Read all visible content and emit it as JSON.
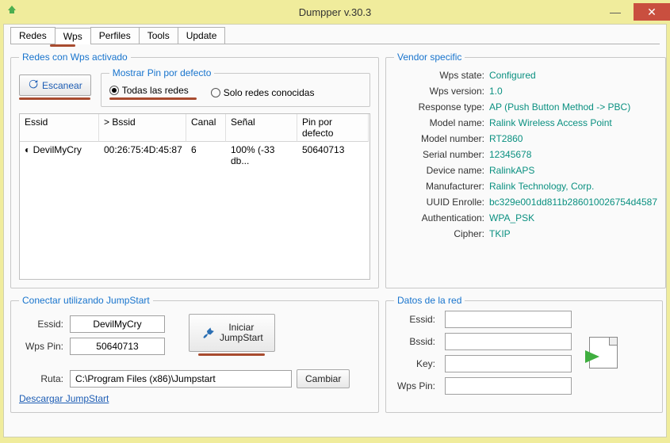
{
  "window": {
    "title": "Dumpper v.30.3"
  },
  "tabs": [
    "Redes",
    "Wps",
    "Perfiles",
    "Tools",
    "Update"
  ],
  "active_tab_index": 1,
  "scan": {
    "group_label": "Redes con Wps activado",
    "button": "Escanear",
    "pin_default_label": "Mostrar Pin por defecto",
    "radio_all": "Todas las redes",
    "radio_known": "Solo redes conocidas"
  },
  "table": {
    "headers": {
      "essid": "Essid",
      "bssid": "> Bssid",
      "canal": "Canal",
      "senal": "Señal",
      "pin": "Pin por defecto"
    },
    "rows": [
      {
        "essid": "DevilMyCry",
        "bssid": "00:26:75:4D:45:87",
        "canal": "6",
        "senal": "100% (-33 db...",
        "pin": "50640713"
      }
    ]
  },
  "vendor": {
    "group_label": "Vendor specific",
    "rows": [
      {
        "label": "Wps state:",
        "value": "Configured"
      },
      {
        "label": "Wps version:",
        "value": "1.0"
      },
      {
        "label": "Response type:",
        "value": "AP (Push Button Method -> PBC)"
      },
      {
        "label": "Model name:",
        "value": "Ralink Wireless Access Point"
      },
      {
        "label": "Model number:",
        "value": "RT2860"
      },
      {
        "label": "Serial number:",
        "value": "12345678"
      },
      {
        "label": "Device name:",
        "value": "RalinkAPS"
      },
      {
        "label": "Manufacturer:",
        "value": "Ralink Technology, Corp."
      },
      {
        "label": "UUID Enrolle:",
        "value": "bc329e001dd811b286010026754d4587"
      },
      {
        "label": "Authentication:",
        "value": "WPA_PSK"
      },
      {
        "label": "Cipher:",
        "value": "TKIP"
      }
    ]
  },
  "connect": {
    "group_label": "Conectar utilizando JumpStart",
    "essid_label": "Essid:",
    "essid_value": "DevilMyCry",
    "wpspin_label": "Wps Pin:",
    "wpspin_value": "50640713",
    "start_label_l1": "Iniciar",
    "start_label_l2": "JumpStart",
    "ruta_label": "Ruta:",
    "ruta_value": "C:\\Program Files (x86)\\Jumpstart",
    "change_button": "Cambiar",
    "download_link": "Descargar JumpStart"
  },
  "netdata": {
    "group_label": "Datos de la red",
    "essid_label": "Essid:",
    "bssid_label": "Bssid:",
    "key_label": "Key:",
    "wpspin_label": "Wps Pin:",
    "essid": "",
    "bssid": "",
    "key": "",
    "wpspin": ""
  }
}
